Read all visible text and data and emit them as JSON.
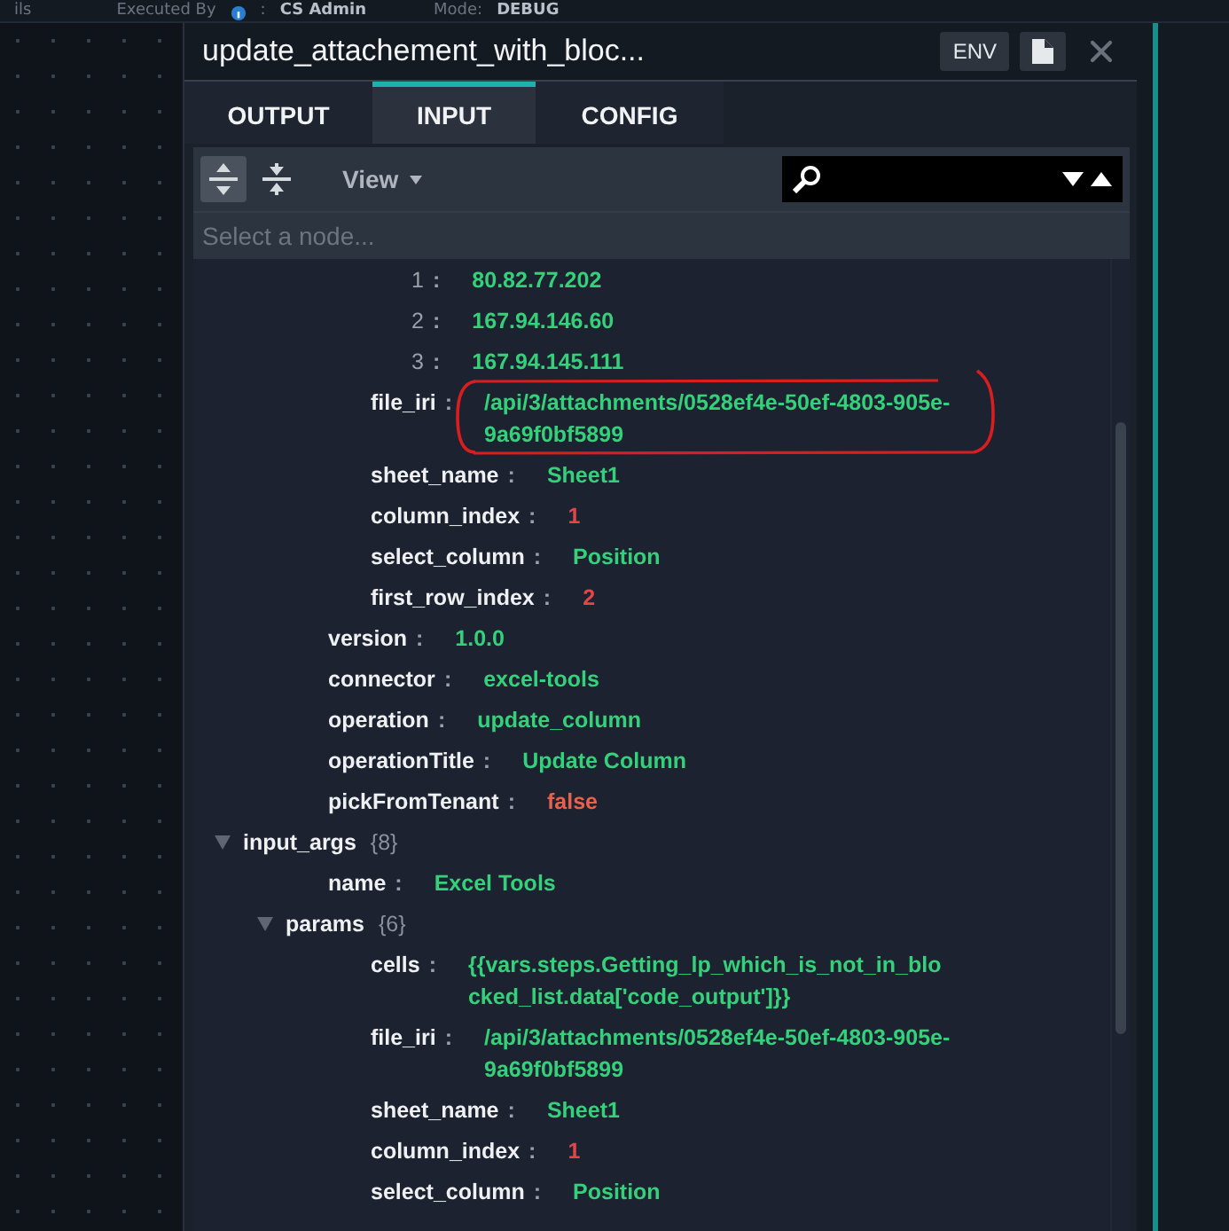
{
  "top_bar": {
    "partial_label": "ils",
    "executed_by_label": "Executed By",
    "separator": ":",
    "executed_by_value": "CS Admin",
    "mode_label": "Mode:",
    "mode_value": "DEBUG"
  },
  "window": {
    "title": "update_attachement_with_bloc...",
    "env_button": "ENV"
  },
  "tabs": [
    {
      "label": "OUTPUT",
      "selected": false
    },
    {
      "label": "INPUT",
      "selected": true
    },
    {
      "label": "CONFIG",
      "selected": false
    }
  ],
  "toolbar": {
    "expand_all_selected": true,
    "view_menu": "View"
  },
  "node_filter": {
    "placeholder": "Select a node..."
  },
  "tree": [
    {
      "kind": "hidden",
      "children": [
        {
          "kind": "hidden",
          "children": [
            {
              "kind": "hidden",
              "children": [
                {
                  "kind": "index",
                  "key": "1",
                  "separator": ":",
                  "value": "80.82.77.202",
                  "color": "#34d17a"
                },
                {
                  "kind": "index",
                  "key": "2",
                  "separator": ":",
                  "value": "167.94.146.60",
                  "color": "#34d17a"
                },
                {
                  "kind": "index",
                  "key": "3",
                  "separator": ":",
                  "value": "167.94.145.111",
                  "color": "#34d17a"
                }
              ]
            },
            {
              "kind": "field",
              "key": "file_iri",
              "separator": ":",
              "value": "/api/3/attachments/0528ef4e-50ef-4803-905e-9a69f0bf5899",
              "color": "#34d17a"
            },
            {
              "kind": "field",
              "key": "sheet_name",
              "separator": ":",
              "value": "Sheet1",
              "color": "#34d17a"
            },
            {
              "kind": "field",
              "key": "column_index",
              "separator": ":",
              "value": "1",
              "color": "#e0464a"
            },
            {
              "kind": "field",
              "key": "select_column",
              "separator": ":",
              "value": "Position",
              "color": "#34d17a"
            },
            {
              "kind": "field",
              "key": "first_row_index",
              "separator": ":",
              "value": "2",
              "color": "#e0464a"
            }
          ]
        },
        {
          "kind": "field",
          "key": "version",
          "separator": ":",
          "value": "1.0.0",
          "color": "#34d17a"
        },
        {
          "kind": "field",
          "key": "connector",
          "separator": ":",
          "value": "excel-tools",
          "color": "#34d17a"
        },
        {
          "kind": "field",
          "key": "operation",
          "separator": ":",
          "value": "update_column",
          "color": "#34d17a"
        },
        {
          "kind": "field",
          "key": "operationTitle",
          "separator": ":",
          "value": "Update Column",
          "color": "#34d17a"
        },
        {
          "kind": "field",
          "key": "pickFromTenant",
          "separator": ":",
          "value": "false",
          "color": "#e8614b"
        }
      ]
    },
    {
      "kind": "branch",
      "key": "input_args",
      "count": "{8}",
      "expanded": true,
      "children": [
        {
          "kind": "field",
          "key": "name",
          "separator": ":",
          "value": "Excel Tools",
          "color": "#34d17a"
        },
        {
          "kind": "branch",
          "key": "params",
          "count": "{6}",
          "expanded": true,
          "children": [
            {
              "kind": "field",
              "key": "cells",
              "separator": ":",
              "value": "{{vars.steps.Getting_lp_which_is_not_in_blocked_list.data['code_output']}}",
              "color": "#34d17a"
            },
            {
              "kind": "field",
              "key": "file_iri",
              "separator": ":",
              "value": "/api/3/attachments/0528ef4e-50ef-4803-905e-9a69f0bf5899",
              "color": "#34d17a"
            },
            {
              "kind": "field",
              "key": "sheet_name",
              "separator": ":",
              "value": "Sheet1",
              "color": "#34d17a"
            },
            {
              "kind": "field",
              "key": "column_index",
              "separator": ":",
              "value": "1",
              "color": "#e0464a"
            },
            {
              "kind": "field",
              "key": "select_column",
              "separator": ":",
              "value": "Position",
              "color": "#34d17a"
            }
          ]
        }
      ]
    }
  ]
}
